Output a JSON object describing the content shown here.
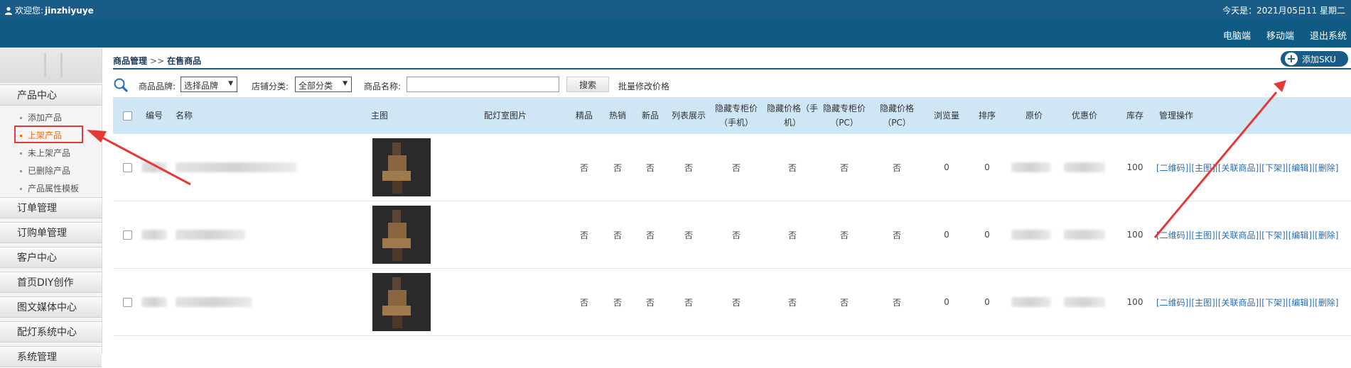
{
  "topbar": {
    "welcome_prefix": "欢迎您:",
    "username": "jinzhiyuye",
    "date_text": "今天是：2021月05日11 星期二"
  },
  "nav": {
    "links": [
      "电脑端",
      "移动端",
      "退出系统"
    ]
  },
  "sidebar": {
    "groups": [
      {
        "label": "产品中心"
      },
      {
        "label": "订单管理"
      },
      {
        "label": "订购单管理"
      },
      {
        "label": "客户中心"
      },
      {
        "label": "首页DIY创作"
      },
      {
        "label": "图文媒体中心"
      },
      {
        "label": "配灯系统中心"
      },
      {
        "label": "系统管理"
      }
    ],
    "items": [
      {
        "label": "添加产品",
        "active": false
      },
      {
        "label": "上架产品",
        "active": true
      },
      {
        "label": "未上架产品",
        "active": false
      },
      {
        "label": "已删除产品",
        "active": false
      },
      {
        "label": "产品属性模板",
        "active": false
      }
    ]
  },
  "breadcrumb": {
    "root": "商品管理",
    "sep": ">>",
    "current": "在售商品"
  },
  "add_sku_label": "添加SKU",
  "filter": {
    "brand_label": "商品品牌:",
    "brand_value": "选择品牌",
    "category_label": "店铺分类:",
    "category_value": "全部分类",
    "name_label": "商品名称:",
    "name_value": "",
    "search_label": "搜索",
    "batch_label": "批量修改价格"
  },
  "table": {
    "headers": {
      "id": "编号",
      "name": "名称",
      "main_img": "主图",
      "lamp_img": "配灯室图片",
      "premium": "精品",
      "hot": "热销",
      "new": "新品",
      "list_show": "列表展示",
      "hide_counter_mobile": "隐藏专柜价（手机）",
      "hide_price_mobile": "隐藏价格（手机）",
      "hide_counter_pc": "隐藏专柜价（PC）",
      "hide_price_pc": "隐藏价格（PC）",
      "views": "浏览量",
      "sort": "排序",
      "orig_price": "原价",
      "sale_price": "优惠价",
      "stock": "库存",
      "ops": "管理操作"
    },
    "rows": [
      {
        "flags": [
          "否",
          "否",
          "否",
          "否",
          "否",
          "否",
          "否",
          "否"
        ],
        "views": "0",
        "sort": "0",
        "stock": "100"
      },
      {
        "flags": [
          "否",
          "否",
          "否",
          "否",
          "否",
          "否",
          "否",
          "否"
        ],
        "views": "0",
        "sort": "0",
        "stock": "100"
      },
      {
        "flags": [
          "否",
          "否",
          "否",
          "否",
          "否",
          "否",
          "否",
          "否"
        ],
        "views": "0",
        "sort": "0",
        "stock": "100"
      }
    ],
    "ops": [
      "[二维码]",
      "[主图]",
      "[关联商品]",
      "[下架]",
      "[编辑]",
      "[删除]"
    ],
    "ops_sep": "|"
  },
  "colors": {
    "header_blue": "#1a5c88",
    "table_head": "#cfe6f5",
    "active_orange": "#ff6600",
    "annotation_red": "#e53935",
    "link_blue": "#2a6db5"
  }
}
